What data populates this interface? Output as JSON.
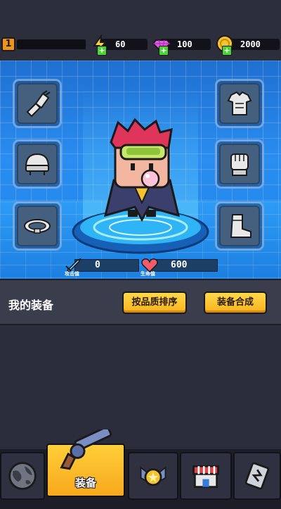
{
  "header": {
    "level": "1",
    "energy": "60",
    "gems": "100",
    "coins": "2000"
  },
  "slots": {
    "left": [
      "gauntlet-icon",
      "helmet-icon",
      "belt-icon"
    ],
    "right": [
      "armor-icon",
      "glove-icon",
      "boot-icon"
    ]
  },
  "stats": {
    "attack_label": "攻击值",
    "attack_value": "0",
    "health_label": "生命值",
    "health_value": "600"
  },
  "equipment": {
    "title": "我的装备",
    "sort_button": "按品质排序",
    "merge_button": "装备合成"
  },
  "nav": {
    "tabs": [
      {
        "name": "world-tab",
        "icon": "globe-icon",
        "label": ""
      },
      {
        "name": "equipment-tab",
        "icon": "pistol-icon",
        "label": "装备",
        "active": true
      },
      {
        "name": "talent-tab",
        "icon": "badge-icon",
        "label": ""
      },
      {
        "name": "shop-tab",
        "icon": "shop-icon",
        "label": ""
      },
      {
        "name": "challenge-tab",
        "icon": "scroll-icon",
        "label": ""
      }
    ]
  },
  "colors": {
    "accent": "#f7b31f",
    "room_blue": "#2a8df0",
    "panel": "#3a3d4b",
    "background": "#2b2d3a"
  }
}
